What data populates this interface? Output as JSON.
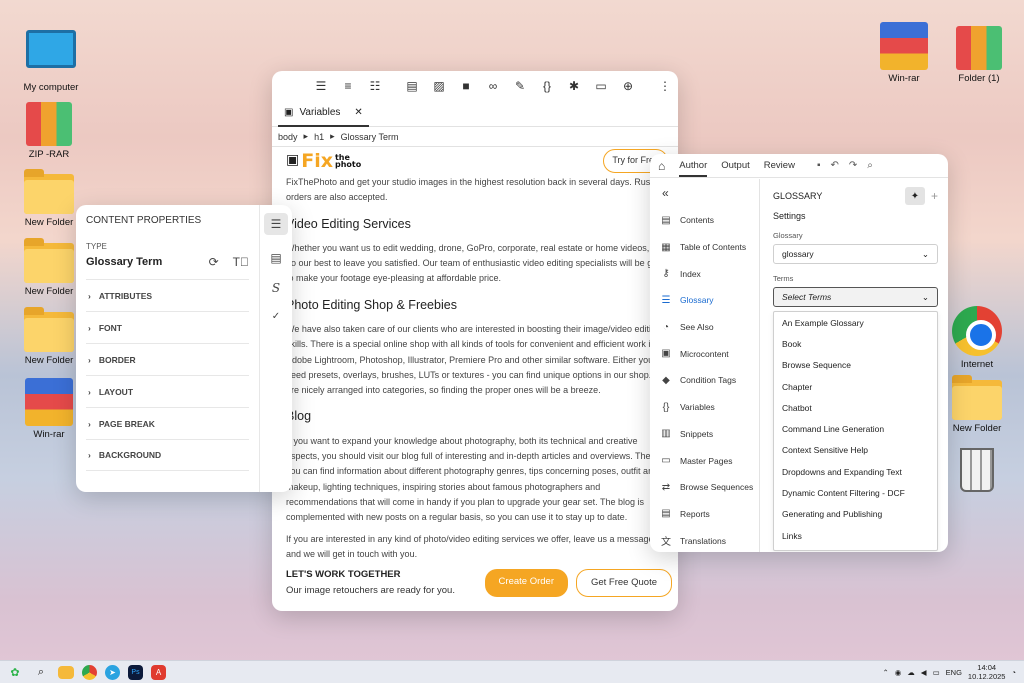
{
  "desktop": {
    "left_icons": [
      {
        "label": "My computer",
        "icon": "monitor-icon"
      },
      {
        "label": "ZIP -RAR",
        "icon": "binder-icon"
      },
      {
        "label": "New Folder",
        "icon": "folder-icon"
      },
      {
        "label": "New Folder",
        "icon": "folder-icon"
      },
      {
        "label": "New Folder",
        "icon": "folder-icon"
      },
      {
        "label": "Win-rar",
        "icon": "winrar-icon"
      }
    ],
    "right_icons": [
      {
        "label": "Win-rar",
        "icon": "winrar-icon"
      },
      {
        "label": "Folder (1)",
        "icon": "binder-icon"
      },
      {
        "label": "Internet",
        "icon": "chrome-icon"
      },
      {
        "label": "New Folder",
        "icon": "folder-icon"
      },
      {
        "label": "",
        "icon": "trash-icon"
      }
    ]
  },
  "editor": {
    "toolbar_icons": [
      "bulleted-list-icon",
      "numbered-list-icon",
      "multilevel-list-icon",
      "insert-snippet-icon",
      "image-icon",
      "video-icon",
      "link-icon",
      "eraser-icon",
      "variable-icon",
      "asterisk-icon",
      "table-icon",
      "add-icon",
      "column-icon"
    ],
    "tab_label": "Variables",
    "breadcrumb": [
      "body",
      "h1",
      "Glossary Term"
    ],
    "logo_big": "Fix",
    "logo_small_1": "the",
    "logo_small_2": "photo",
    "try_button": "Try for Free",
    "intro": "FixThePhoto and get your studio images in the highest resolution back in several days. Rush orders are also accepted.",
    "h_video": "Video Editing Services",
    "p_video": "Whether you want us to edit wedding, drone, GoPro, corporate, real estate or home videos, we do our best to leave you satisfied. Our team of enthusiastic video editing specialists will be glad to make your footage eye-pleasing at affordable price.",
    "h_shop": "Photo Editing Shop & Freebies",
    "p_shop": "We have also taken care of our clients who are interested in boosting their image/video editing skills. There is a special online shop with all kinds of tools for convenient and efficient work in Adobe Lightroom, Photoshop, Illustrator, Premiere Pro and other similar software. Either you need presets, overlays, brushes, LUTs or textures - you can find unique options in our shop. All are nicely arranged into categories, so finding the proper ones will be a breeze.",
    "h_blog": "Blog",
    "p_blog": "If you want to expand your knowledge about photography, both its technical and creative aspects, you should visit our blog full of interesting and in-depth articles and overviews. There you can find information about different photography genres, tips concerning poses, outfit and makeup, lighting techniques, inspiring stories about famous photographers and recommendations that will come in handy if you plan to upgrade your gear set. The blog is complemented with new posts on a regular basis, so you can use it to stay up to date.",
    "p_contact": "If you are interested in any kind of photo/video editing services we offer, leave us a message and we will get in touch with you.",
    "cta_title": "LET'S WORK TOGETHER",
    "cta_sub": "Our image retouchers are ready for you.",
    "btn_order": "Create Order",
    "btn_quote": "Get Free Quote"
  },
  "props": {
    "title": "CONTENT PROPERTIES",
    "type_label": "TYPE",
    "type_value": "Glossary Term",
    "sections": [
      "ATTRIBUTES",
      "FONT",
      "BORDER",
      "LAYOUT",
      "PAGE BREAK",
      "BACKGROUND"
    ]
  },
  "author": {
    "tabs": [
      "Author",
      "Output",
      "Review"
    ],
    "nav": [
      {
        "label": "Contents",
        "icon": "contents-icon"
      },
      {
        "label": "Table of Contents",
        "icon": "toc-icon"
      },
      {
        "label": "Index",
        "icon": "key-icon"
      },
      {
        "label": "Glossary",
        "icon": "glossary-icon",
        "active": true
      },
      {
        "label": "See Also",
        "icon": "see-also-icon"
      },
      {
        "label": "Microcontent",
        "icon": "microcontent-icon"
      },
      {
        "label": "Condition Tags",
        "icon": "tag-icon"
      },
      {
        "label": "Variables",
        "icon": "variables-icon"
      },
      {
        "label": "Snippets",
        "icon": "snippets-icon"
      },
      {
        "label": "Master Pages",
        "icon": "master-pages-icon"
      },
      {
        "label": "Browse Sequences",
        "icon": "browse-icon"
      },
      {
        "label": "Reports",
        "icon": "reports-icon"
      },
      {
        "label": "Translations",
        "icon": "translate-icon"
      }
    ],
    "section_title": "GLOSSARY",
    "settings_label": "Settings",
    "glossary_label": "Glossary",
    "glossary_value": "glossary",
    "terms_label": "Terms",
    "terms_placeholder": "Select Terms",
    "terms_options": [
      "An Example Glossary",
      "Book",
      "Browse Sequence",
      "Chapter",
      "Chatbot",
      "Command Line Generation",
      "Context Sensitive Help",
      "Dropdowns and Expanding Text",
      "Dynamic Content Filtering - DCF",
      "Generating and Publishing",
      "Links"
    ]
  },
  "taskbar": {
    "apps": [
      "start-icon",
      "search-icon",
      "file-explorer-icon",
      "chrome-icon",
      "telegram-icon",
      "photoshop-icon",
      "acrobat-icon"
    ],
    "lang": "ENG",
    "time": "14:04",
    "date": "10.12.2025"
  }
}
